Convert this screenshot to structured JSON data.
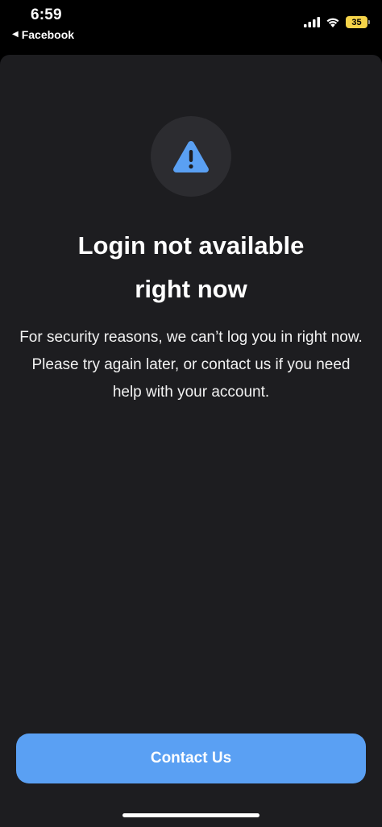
{
  "status_bar": {
    "time": "6:59",
    "back_app_label": "Facebook",
    "battery_level": "35",
    "battery_color": "#f5d34a"
  },
  "dialog": {
    "icon": "warning-triangle-icon",
    "title_line1": "Login not available",
    "title_line2": "right now",
    "message": "For security reasons, we can’t log you in right now. Please try again later, or contact us if you need help with your account.",
    "button_label": "Contact Us"
  },
  "colors": {
    "sheet_background": "#1d1d20",
    "accent": "#5aa0f3",
    "icon_circle": "#2c2c30"
  }
}
